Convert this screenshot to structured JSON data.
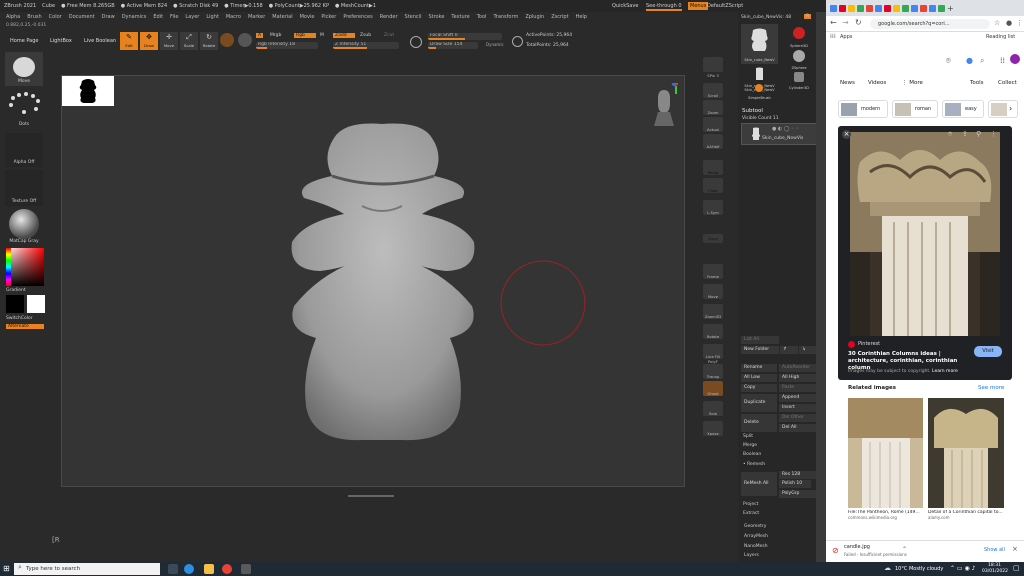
{
  "zbrush": {
    "title": "ZBrush 2021",
    "title_items": [
      "Cube",
      "● Free Mem 8.265GB",
      "● Active Mem 824",
      "● Scratch Disk 49",
      "● Timer▶0.158",
      "● PolyCount▶25.962 KP",
      "● MeshCount▶1"
    ],
    "quicksave": "QuickSave",
    "see_through": "See-through 0",
    "menus_btn": "Menus",
    "default_script": "DefaultZScript",
    "menu": [
      "Alpha",
      "Brush",
      "Color",
      "Document",
      "Draw",
      "Dynamics",
      "Edit",
      "File",
      "Layer",
      "Light",
      "Macro",
      "Marker",
      "Material",
      "Movie",
      "Picker",
      "Preferences",
      "Render",
      "Stencil",
      "Stroke",
      "Texture",
      "Tool",
      "Transform",
      "Zplugin",
      "Zscript",
      "Help"
    ],
    "coords": "0.882,0.25,-0.031",
    "toolbar": {
      "home": "Home Page",
      "lightbox": "LightBox",
      "live_boolean": "Live Boolean",
      "edit": "Edit",
      "draw": "Draw",
      "move": "Move",
      "scale": "Scale",
      "rotate": "Rotate",
      "a": "A",
      "mrgb": "Mrgb",
      "rgb": "Rgb",
      "m": "M",
      "zadd": "Zadd",
      "zsub": "Zsub",
      "zcut": "Zcut",
      "rgb_intensity": "Rgb Intensity 18",
      "z_intensity": "Z Intensity 51",
      "focal_shift": "Focal Shift 0",
      "draw_size": "Draw Size 154",
      "dynamic": "Dynamic",
      "active_points": "ActivePoints: 25,964",
      "total_points": "TotalPoints: 25,964"
    },
    "left_shelf": {
      "move": "Move",
      "dots": "Dots",
      "alpha_off": "Alpha Off",
      "texture_off": "Texture Off",
      "matcap": "MatCap Gray",
      "gradient": "Gradient",
      "switch_color": "SwitchColor",
      "alternate": "Alternate"
    },
    "right_shelf": [
      "SPix 3",
      "Scroll",
      "Zoom",
      "Actual",
      "AAHalf",
      "Persp",
      "Floor",
      "L.Sym",
      "Qxyz",
      "Frame",
      "Move",
      "Zoom3D",
      "Rotate",
      "Line Fill PolyF",
      "Transp",
      "Ghost",
      "Solo",
      "Xpose"
    ],
    "tool_panel": {
      "current_tool": "Skin_cube_NewVis: 48",
      "r": "R",
      "thumbs": [
        "Skin_cube_NewV",
        "Sphere3D",
        "Skin_cube_NewV",
        "ZSphere",
        "Skin_cube_NewV",
        "Cylinder3D",
        "SimpleBrush"
      ],
      "subtool": "Subtool",
      "visible_count": "Visible Count 11",
      "subtool_item": "Skin_cube_NewVis",
      "list_all": "List All",
      "new_folder": "New Folder",
      "rename": "Rename",
      "autoreorder": "AutoReorder",
      "all_low": "All Low",
      "all_high": "All High",
      "copy": "Copy",
      "paste": "Paste",
      "duplicate": "Duplicate",
      "append": "Append",
      "insert": "Insert",
      "delete": "Delete",
      "del_other": "Del Other",
      "del_all": "Del All",
      "split": "Split",
      "merge": "Merge",
      "boolean": "Boolean",
      "remesh": "Remesh",
      "res": "Res 128",
      "polish": "Polish 10",
      "remesh_all": "ReMesh All",
      "polygrp": "PolyGrp",
      "project": "Project",
      "extract": "Extract",
      "geometry": "Geometry",
      "arraymesh": "ArrayMesh",
      "nanomesh": "NanoMesh",
      "layers": "Layers"
    },
    "bottom_hint": "[R"
  },
  "browser": {
    "url": "google.com/search?q=cori...",
    "apps": "Apps",
    "reading_list": "Reading list",
    "tabs_nav": [
      "News",
      "Videos",
      "More",
      "Tools",
      "Collect"
    ],
    "chips": [
      "modern",
      "roman",
      "easy"
    ],
    "source": "Pinterest",
    "image_title": "30 Corinthian Columns ideas | architecture, corinthian, corinthian column",
    "copyright": "Images may be subject to copyright.",
    "learn_more": "Learn more",
    "visit": "Visit",
    "related": "Related images",
    "see_more": "See more",
    "related_items": [
      {
        "title": "File:The Pantheon, Rome (149...",
        "source": "commons.wikimedia.org"
      },
      {
        "title": "Detail of a Corinthian capital to...",
        "source": "alamy.com"
      }
    ],
    "download_name": "candle.jpg",
    "download_status": "Failed - Insufficient permissions",
    "show_all": "Show all"
  },
  "taskbar": {
    "search_placeholder": "Type here to search",
    "weather": "10°C  Mostly cloudy",
    "time": "18:31",
    "date": "03/01/2022"
  },
  "colors": {
    "accent": "#e8821f",
    "zbrush_bg": "#2a2a2a",
    "canvas_bg": "#343434",
    "google_blue": "#1a73e8"
  }
}
